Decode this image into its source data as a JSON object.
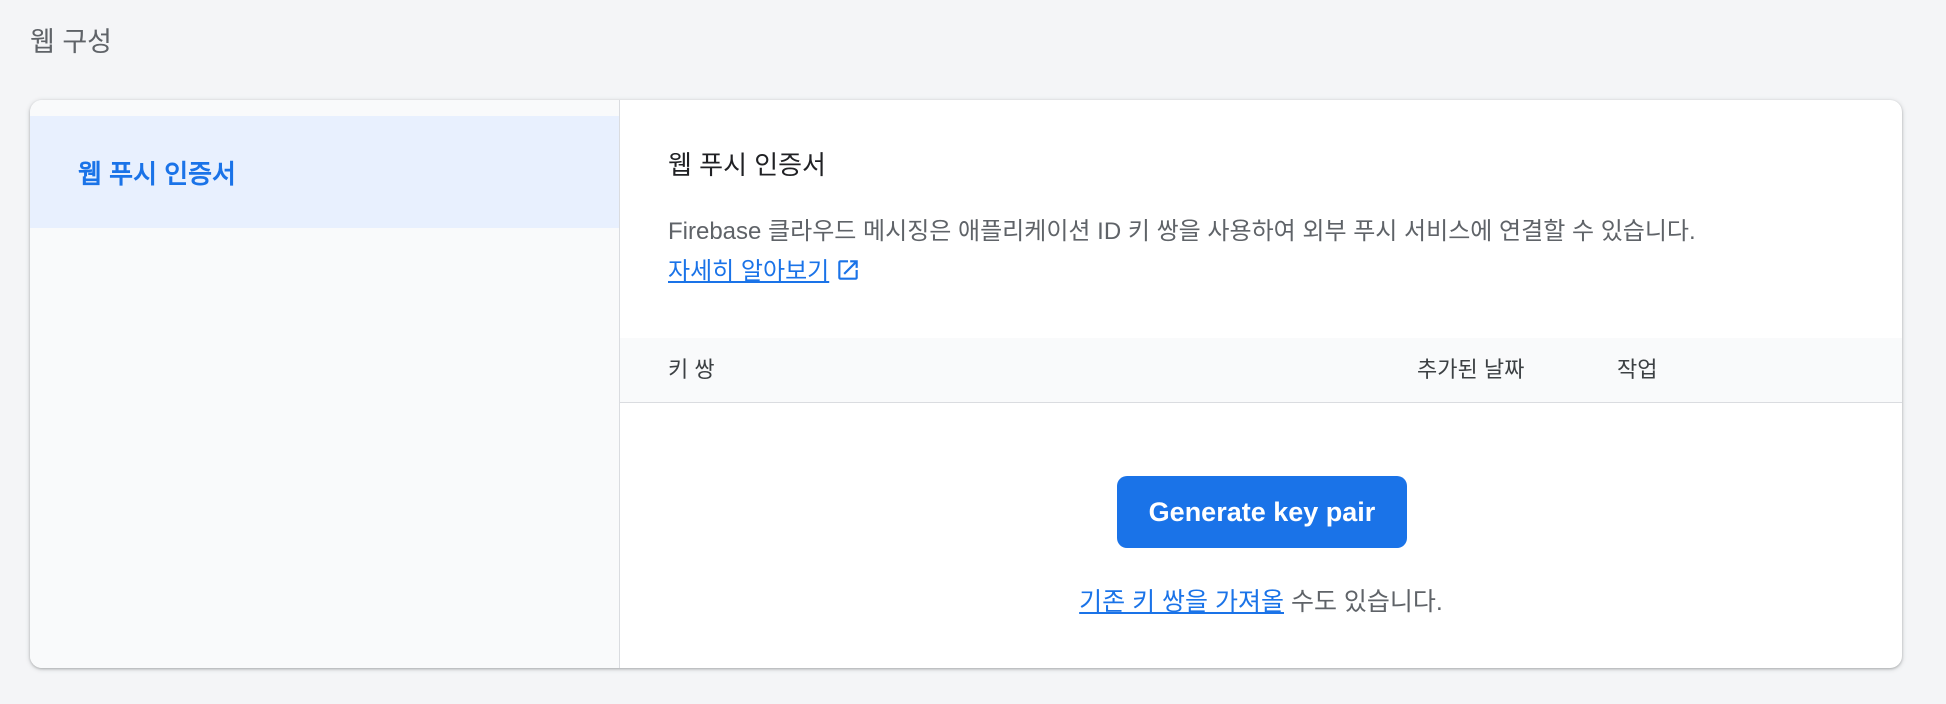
{
  "page": {
    "title": "웹 구성"
  },
  "sidebar": {
    "items": [
      {
        "label": "웹 푸시 인증서",
        "selected": true
      }
    ]
  },
  "main": {
    "section_title": "웹 푸시 인증서",
    "description": "Firebase 클라우드 메시징은 애플리케이션 ID 키 쌍을 사용하여 외부 푸시 서비스에 연결할 수 있습니다.",
    "learn_more": "자세히 알아보기",
    "table": {
      "columns": [
        "키 쌍",
        "추가된 날짜",
        "작업"
      ]
    },
    "generate_button": "Generate key pair",
    "import_link": "기존 키 쌍을 가져올",
    "import_suffix": " 수도 있습니다."
  },
  "colors": {
    "accent": "#1a73e8",
    "sidebar_selected_bg": "#e8f0fe",
    "page_bg": "#f4f5f7"
  },
  "icons": {
    "external_link": "open-in-new-icon"
  }
}
